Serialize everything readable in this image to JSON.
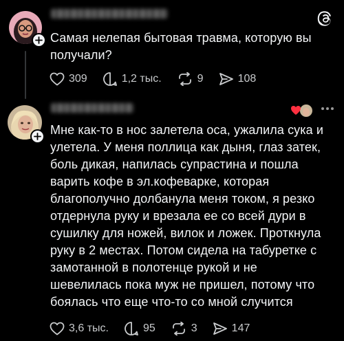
{
  "post1": {
    "text_lines": [
      "Самая нелепая бытовая травма, которую вы",
      "получали?"
    ],
    "likes": "309",
    "replies": "1,2 тыс.",
    "reposts": "9",
    "shares": "108"
  },
  "post2": {
    "text_lines": [
      "Мне как-то в нос залетела оса, ужалила сука и",
      "улетела. У меня поллица как дыня, глаз затек,",
      "боль дикая, напилась супрастина и пошла",
      "варить кофе в эл.кофеварке, которая",
      "благополучно долбанула меня током, я резко",
      "отдернула руку и врезала ее со всей дури  в",
      "сушилку для ножей, вилок и ложек. Проткнула",
      "руку в 2 местах. Потом сидела на табуретке с",
      "замотанной в полотенце рукой и не",
      "шевелилась пока муж не пришел, потому что",
      "боялась что еще что-то со мной случится"
    ],
    "likes": "3,6 тыс.",
    "replies": "95",
    "reposts": "3",
    "shares": "147"
  },
  "icons": {
    "like": "heart-icon",
    "reply": "comment-bubble-icon",
    "repost": "repost-icon",
    "share": "send-icon",
    "logo": "threads-logo-icon",
    "more": "more-dots-icon"
  },
  "colors": {
    "background": "#000000",
    "text": "#f3f5f7",
    "meta": "#c9cbcd",
    "thread_line": "#333638"
  }
}
